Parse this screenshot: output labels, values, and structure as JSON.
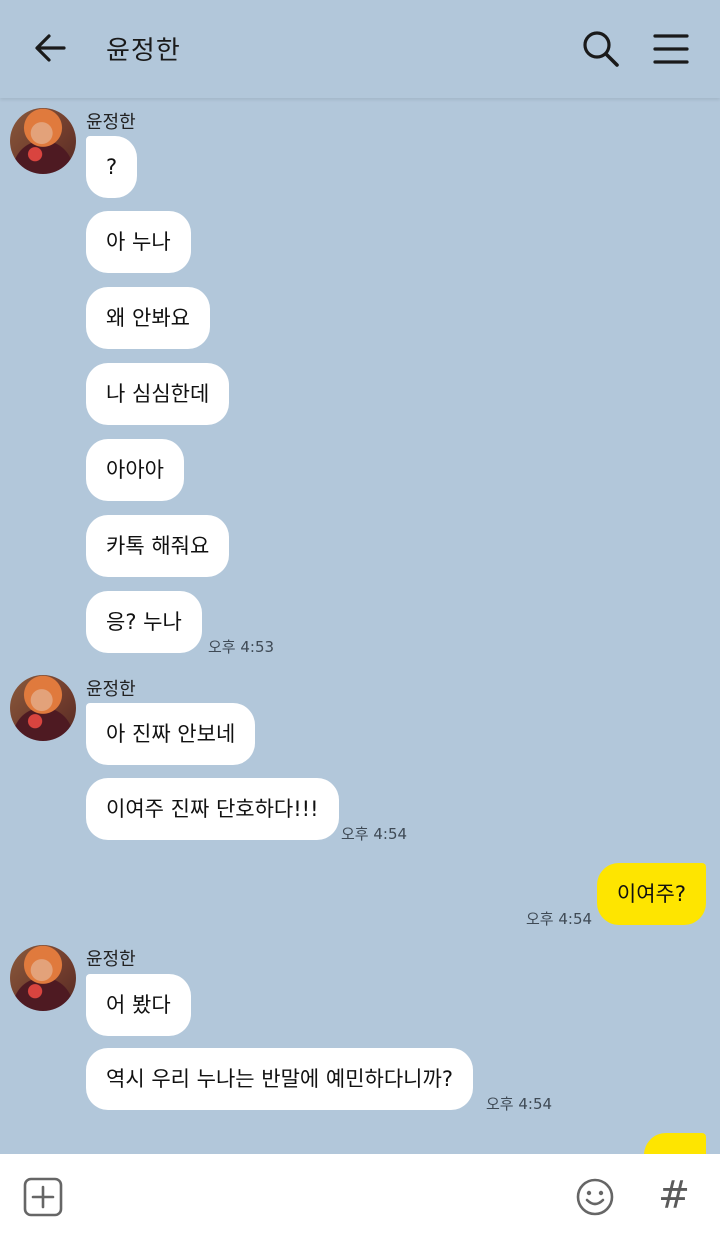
{
  "header": {
    "title": "윤정한"
  },
  "messages": {
    "group1": {
      "sender": "윤정한",
      "bubbles": [
        "?",
        "아 누나",
        "왜 안봐요",
        "나 심심한데",
        "아아아",
        "카톡 해줘요",
        "응? 누나"
      ],
      "time": "오후 4:53"
    },
    "group2": {
      "sender": "윤정한",
      "bubbles": [
        "아 진짜 안보네",
        "이여주 진짜 단호하다!!!"
      ],
      "time": "오후 4:54"
    },
    "mine1": {
      "bubbles": [
        "이여주?"
      ],
      "time": "오후 4:54"
    },
    "group3": {
      "sender": "윤정한",
      "bubbles": [
        "어 봤다",
        "역시 우리 누나는 반말에 예민하다니까?"
      ],
      "time": "오후 4:54"
    }
  },
  "bottom": {
    "hash": "#"
  },
  "colors": {
    "background": "#b2c7da",
    "incoming_bubble": "#ffffff",
    "outgoing_bubble": "#fee500"
  },
  "icons": {
    "back": "arrow-left-icon",
    "search": "search-icon",
    "menu": "menu-icon",
    "add": "plus-square-icon",
    "emoji": "smiley-icon"
  }
}
